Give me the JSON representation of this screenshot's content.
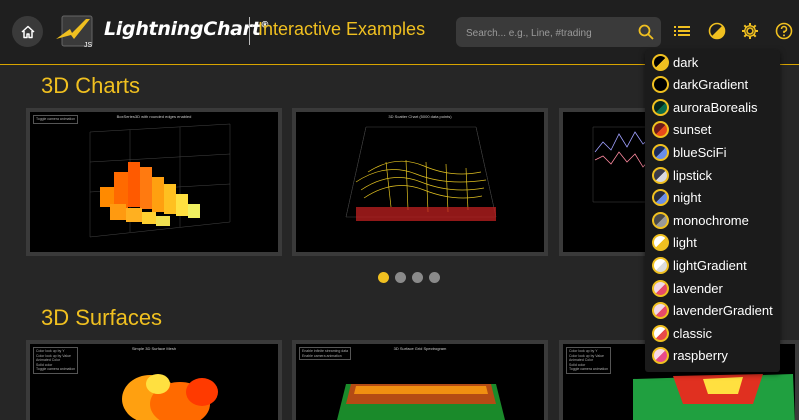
{
  "header": {
    "brand": "LightningChart",
    "brand_mark": "®",
    "logo_sub": "JS",
    "subtitle": "Interactive Examples",
    "search_placeholder": "Search... e.g., Line, #trading",
    "icons": [
      "home-icon",
      "search-icon",
      "list-icon",
      "theme-icon",
      "gear-icon",
      "help-icon"
    ]
  },
  "sections": [
    {
      "title": "3D Charts",
      "cards": [
        {
          "title": "BoxSeries3D with rounded edges enabled",
          "legend": [
            "Toggle camera animation"
          ]
        },
        {
          "title": "3D Scatter Chart (5000 data points)",
          "legend": []
        },
        {
          "title": "",
          "legend": []
        }
      ]
    },
    {
      "title": "3D Surfaces",
      "cards": [
        {
          "title": "Simple 3D Surface Mesh",
          "legend": [
            "Color look up by Y",
            "Color look up by Value",
            "Animated Color",
            "Solid color",
            "Toggle camera animation"
          ]
        },
        {
          "title": "3D Surface Grid Spectrogram",
          "legend": [
            "Enable infinite streaming data",
            "Enable camera animation"
          ]
        },
        {
          "title": "",
          "legend": [
            "Color look up by Y",
            "Color look up by Value",
            "Animated Color",
            "Solid color",
            "Toggle camera animation"
          ]
        }
      ]
    }
  ],
  "carousel": {
    "count": 4,
    "active": 0
  },
  "theme_menu": {
    "items": [
      {
        "label": "dark",
        "colors": [
          "#f0c020",
          "#000000"
        ]
      },
      {
        "label": "darkGradient",
        "colors": [
          "#000000",
          "#000000"
        ]
      },
      {
        "label": "auroraBorealis",
        "colors": [
          "#0b6b4a",
          "#04251c"
        ]
      },
      {
        "label": "sunset",
        "colors": [
          "#e84a1a",
          "#6a1a1a"
        ]
      },
      {
        "label": "blueSciFi",
        "colors": [
          "#6a8ee8",
          "#1a2a5a"
        ]
      },
      {
        "label": "lipstick",
        "colors": [
          "#d8d8e0",
          "#3a3a4a"
        ]
      },
      {
        "label": "night",
        "colors": [
          "#6a8ee8",
          "#262a3a"
        ]
      },
      {
        "label": "monochrome",
        "colors": [
          "#9a9a9a",
          "#4a4a4a"
        ]
      },
      {
        "label": "light",
        "colors": [
          "#f0c020",
          "#ffffff"
        ]
      },
      {
        "label": "lightGradient",
        "colors": [
          "#dcdcdc",
          "#ffffff"
        ]
      },
      {
        "label": "lavender",
        "colors": [
          "#e84a6a",
          "#f0d8e8"
        ]
      },
      {
        "label": "lavenderGradient",
        "colors": [
          "#e84a6a",
          "#f0d8e8"
        ]
      },
      {
        "label": "classic",
        "colors": [
          "#e84a4a",
          "#ffffff"
        ]
      },
      {
        "label": "raspberry",
        "colors": [
          "#e84a8a",
          "#f8d8e8"
        ]
      }
    ]
  },
  "colors": {
    "accent": "#f0c020",
    "header_bg": "#1f1f1f",
    "page_bg": "#262626"
  }
}
